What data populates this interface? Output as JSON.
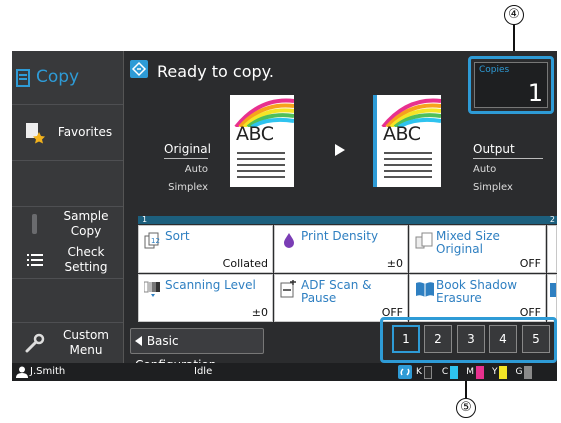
{
  "callouts": {
    "top": "④",
    "bottom": "⑤"
  },
  "sidebar": {
    "items": [
      {
        "label": "Copy",
        "icon": "copy-document-icon"
      },
      {
        "label": "Favorites",
        "icon": "favorites-star-icon"
      },
      {
        "label": "Sample Copy",
        "icon": "sample-copy-icon"
      },
      {
        "label": "Check Setting",
        "icon": "list-icon"
      },
      {
        "label": "Custom Menu",
        "icon": "wrench-icon"
      }
    ]
  },
  "status": {
    "text": "Ready to copy."
  },
  "copies": {
    "label": "Copies",
    "value": "1"
  },
  "preview": {
    "doc_text": "ABC",
    "original": {
      "label": "Original",
      "mode": "Auto",
      "side": "Simplex"
    },
    "output": {
      "label": "Output",
      "mode": "Auto",
      "side": "Simplex"
    }
  },
  "grid": {
    "page_left": "1",
    "page_right": "2",
    "cells": [
      {
        "title": "Sort",
        "value": "Collated",
        "icon": "sort-icon"
      },
      {
        "title": "Print Density",
        "value": "±0",
        "icon": "density-drop-icon"
      },
      {
        "title": "Mixed Size Original",
        "value": "OFF",
        "icon": "mixed-size-icon"
      },
      {
        "title": "Scanning Level",
        "value": "±0",
        "icon": "scanning-level-icon"
      },
      {
        "title": "ADF Scan & Pause",
        "value": "OFF",
        "icon": "adf-scan-icon"
      },
      {
        "title": "Book Shadow Erasure",
        "value": "OFF",
        "icon": "book-icon"
      }
    ]
  },
  "bottom": {
    "basic_label": "Basic Configuration",
    "pages": [
      "1",
      "2",
      "3",
      "4",
      "5"
    ],
    "active_page": "1"
  },
  "statusbar": {
    "user": "J.Smith",
    "state": "Idle",
    "toner": [
      {
        "letter": "K",
        "color": "#2a2a2a"
      },
      {
        "letter": "C",
        "color": "#2ec3ef"
      },
      {
        "letter": "M",
        "color": "#e8318f"
      },
      {
        "letter": "Y",
        "color": "#f4e526"
      },
      {
        "letter": "G",
        "color": "#8a8a8a"
      }
    ]
  },
  "colors": {
    "accent": "#2e9bd6",
    "background": "#2b2c2e"
  }
}
